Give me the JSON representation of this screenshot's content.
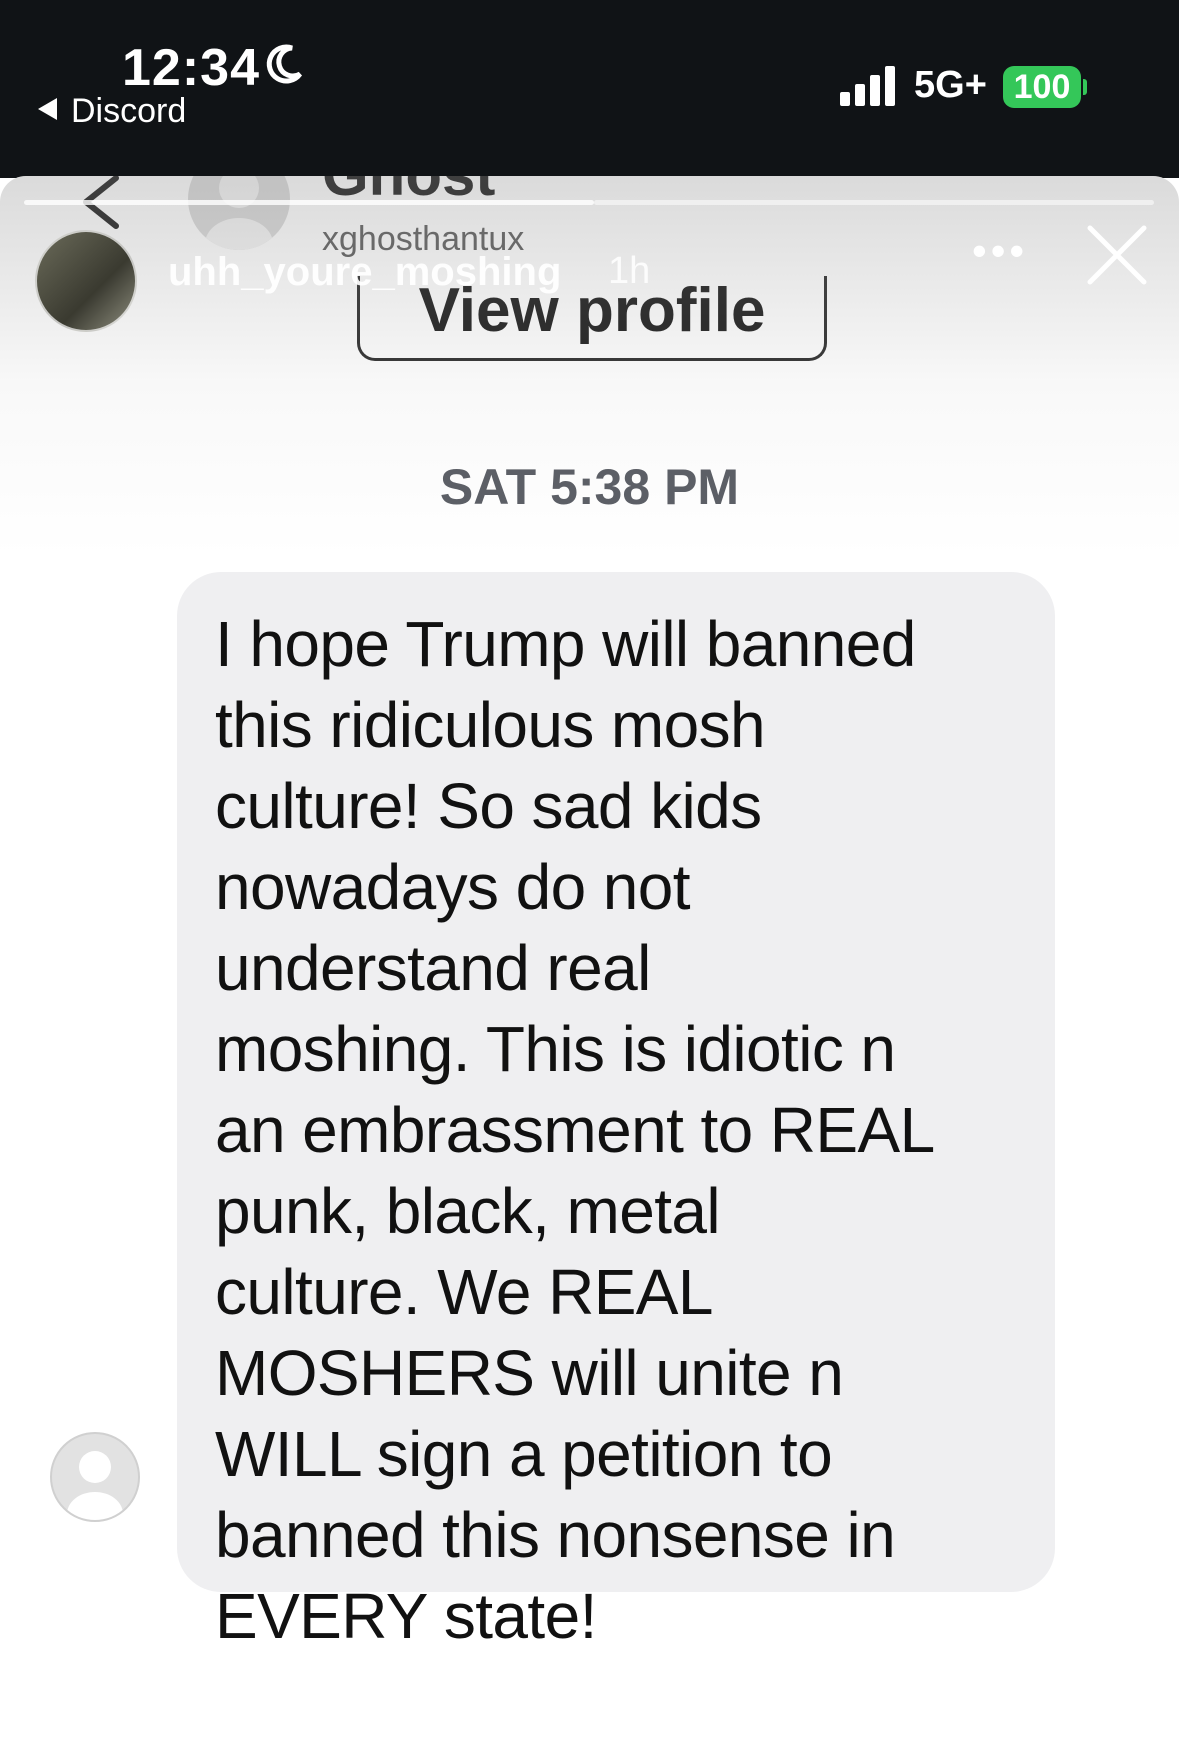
{
  "status_bar": {
    "time": "12:34",
    "back_app": "Discord",
    "network": "5G+",
    "battery": "100"
  },
  "profile_header": {
    "name_partial": "Ghost",
    "handle": "xghosthantux",
    "view_profile_label": "View profile"
  },
  "story_overlay": {
    "username": "uhh_youre_moshing",
    "time_ago": "1h",
    "more_label": "•••"
  },
  "conversation": {
    "timestamp": "SAT 5:38 PM",
    "message": "I hope Trump will banned\nthis ridiculous mosh\nculture! So sad kids\nnowadays do not\nunderstand real\nmoshing. This is idiotic n\nan embrassment to REAL\npunk, black, metal\nculture. We REAL\nMOSHERS will unite n\nWILL sign a petition to\nbanned this nonsense in\nEVERY state!"
  },
  "colors": {
    "status_bar_bg": "#101316",
    "battery_green": "#34c759",
    "bubble_bg": "#efeff1",
    "timestamp_gray": "#5c5f66"
  },
  "icons": [
    "moon-icon",
    "signal-icon",
    "back-chevron-icon",
    "close-icon",
    "more-icon",
    "avatar-placeholder-icon"
  ]
}
